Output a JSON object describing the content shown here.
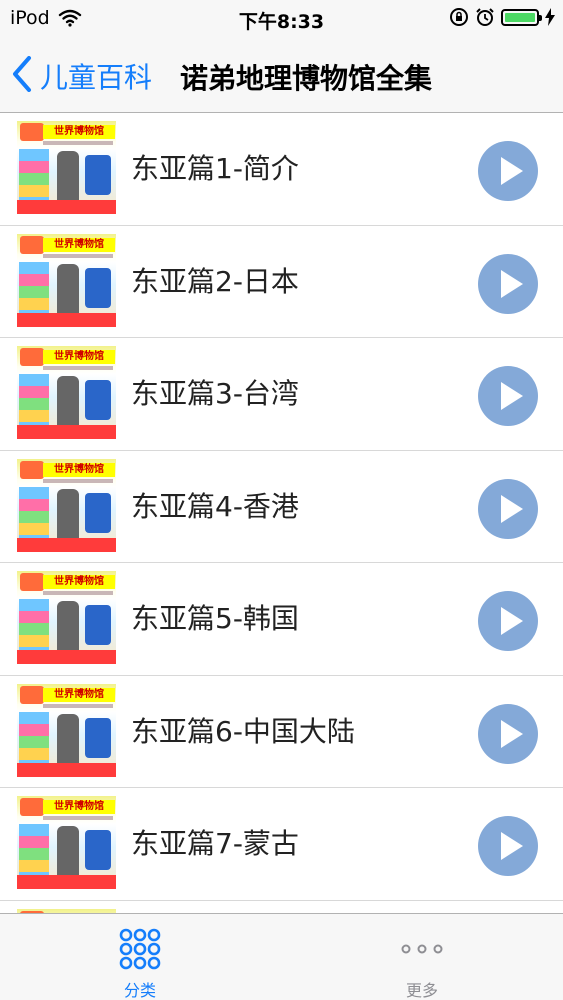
{
  "status_bar": {
    "carrier": "iPod",
    "time": "下午8:33",
    "icons": [
      "wifi-icon",
      "orientation-lock-icon",
      "alarm-icon",
      "battery-icon",
      "charging-icon"
    ],
    "battery_fill": 1.0
  },
  "nav_bar": {
    "back_label": "儿童百科",
    "title": "诺弟地理博物馆全集"
  },
  "thumbnail": {
    "title_text": "世界博物馆"
  },
  "list": {
    "items": [
      {
        "title": "东亚篇1-简介"
      },
      {
        "title": "东亚篇2-日本"
      },
      {
        "title": "东亚篇3-台湾"
      },
      {
        "title": "东亚篇4-香港"
      },
      {
        "title": "东亚篇5-韩国"
      },
      {
        "title": "东亚篇6-中国大陆"
      },
      {
        "title": "东亚篇7-蒙古"
      },
      {
        "title": ""
      }
    ]
  },
  "tab_bar": {
    "tabs": [
      {
        "label": "分类",
        "icon": "grid-icon",
        "active": true
      },
      {
        "label": "更多",
        "icon": "more-dots-icon",
        "active": false
      }
    ]
  },
  "colors": {
    "accent": "#157efb",
    "play_button": "#84a9d8",
    "battery": "#4cd964",
    "bar_background": "#f7f7f7"
  }
}
